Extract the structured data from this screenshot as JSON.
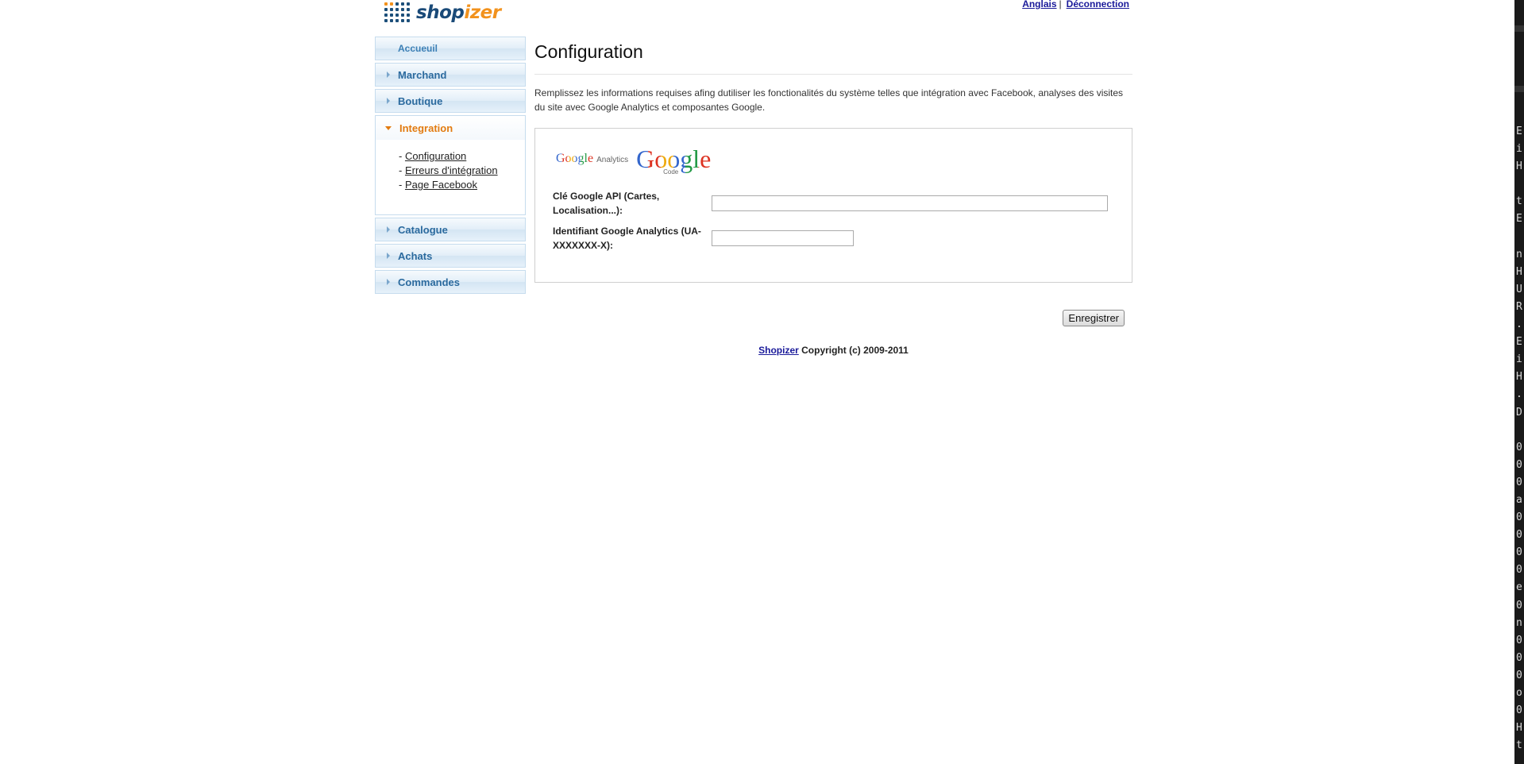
{
  "header": {
    "logo_text_1": "shop",
    "logo_text_2": "izer",
    "lang_link": "Anglais",
    "separator": "|",
    "logout_link": "Déconnection"
  },
  "sidebar": {
    "home": "Accueuil",
    "items": [
      {
        "label": "Marchand"
      },
      {
        "label": "Boutique"
      }
    ],
    "open_section": {
      "label": "Integration",
      "subitems": [
        {
          "prefix": "- ",
          "label": "Configuration"
        },
        {
          "prefix": "- ",
          "label": "Erreurs d'intégration"
        },
        {
          "prefix": "- ",
          "label": "Page Facebook"
        }
      ]
    },
    "items_after": [
      {
        "label": "Catalogue"
      },
      {
        "label": "Achats"
      },
      {
        "label": "Commandes"
      }
    ]
  },
  "main": {
    "title": "Configuration",
    "intro": "Remplissez les informations requises afing dutiliser les fonctionalités du système telles que intégration avec Facebook, analyses des visites du site avec Google Analytics et composantes Google.",
    "google_analytics_logo": {
      "word": "Google",
      "sub": "Analytics"
    },
    "google_code_logo": {
      "word": "Google",
      "sub": "Code"
    },
    "fields": {
      "api_key_label": "Clé Google API (Cartes, Localisation...):",
      "api_key_value": "",
      "analytics_label": "Identifiant Google Analytics (UA-XXXXXXX-X):",
      "analytics_value": ""
    },
    "save_button": "Enregistrer"
  },
  "footer": {
    "link": "Shopizer",
    "text": " Copyright (c) 2009-2011"
  },
  "terminal_strip": {
    "chars": "E\ni\nH\n\nt\nE\n\nn\nH\nU\nR\n.\nE\ni\nH\n.\nD\n\n0\n0\n0\na\n0\n0\n0\n0\ne\n0\nn\n0\n0\n0\no\n0\nH\nt"
  }
}
